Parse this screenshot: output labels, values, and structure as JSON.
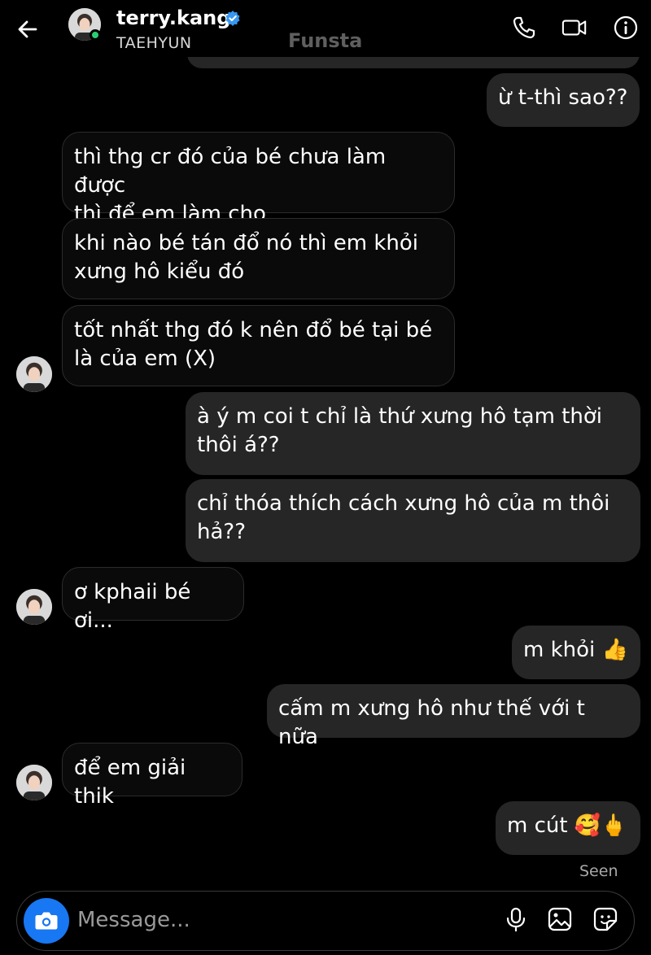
{
  "header": {
    "username": "terry.kang",
    "subname": "TAEHYUN",
    "watermark": "Funsta",
    "icons": [
      "back-arrow-icon",
      "verified-badge-icon",
      "phone-icon",
      "video-camera-icon",
      "info-icon"
    ]
  },
  "messages": [
    {
      "side": "out",
      "text": "ừ t-thì sao??"
    },
    {
      "side": "in",
      "text": "thì thg cr đó của bé chưa làm được\nthì để em làm cho"
    },
    {
      "side": "in",
      "text": "khi nào bé tán đổ nó thì em khỏi\nxưng hô kiểu đó"
    },
    {
      "side": "in",
      "text": "tốt nhất thg đó k nên đổ bé tại bé\nlà của em (X)"
    },
    {
      "side": "out",
      "text": "à ý m coi t chỉ là thứ xưng hô tạm thời\nthôi á??"
    },
    {
      "side": "out",
      "text": "chỉ thóa thích cách xưng hô của m thôi\nhả??"
    },
    {
      "side": "in",
      "text": "ơ kphaii bé ơi..."
    },
    {
      "side": "out",
      "text": "m khỏi 👍"
    },
    {
      "side": "out",
      "text": "cấm m xưng hô như thế với t nữa"
    },
    {
      "side": "in",
      "text": "để em giải thik"
    },
    {
      "side": "out",
      "text": "m cút 🥰🖕"
    }
  ],
  "status": {
    "seen": "Seen"
  },
  "composer": {
    "placeholder": "Message...",
    "icons": [
      "camera-icon",
      "microphone-icon",
      "gallery-icon",
      "sticker-icon"
    ]
  },
  "colors": {
    "background": "#000000",
    "outgoing_bubble": "#262626",
    "incoming_border": "#2c2c2c",
    "camera_button": "#1877f2",
    "online_dot": "#2ecc71",
    "verified": "#3897f0"
  }
}
